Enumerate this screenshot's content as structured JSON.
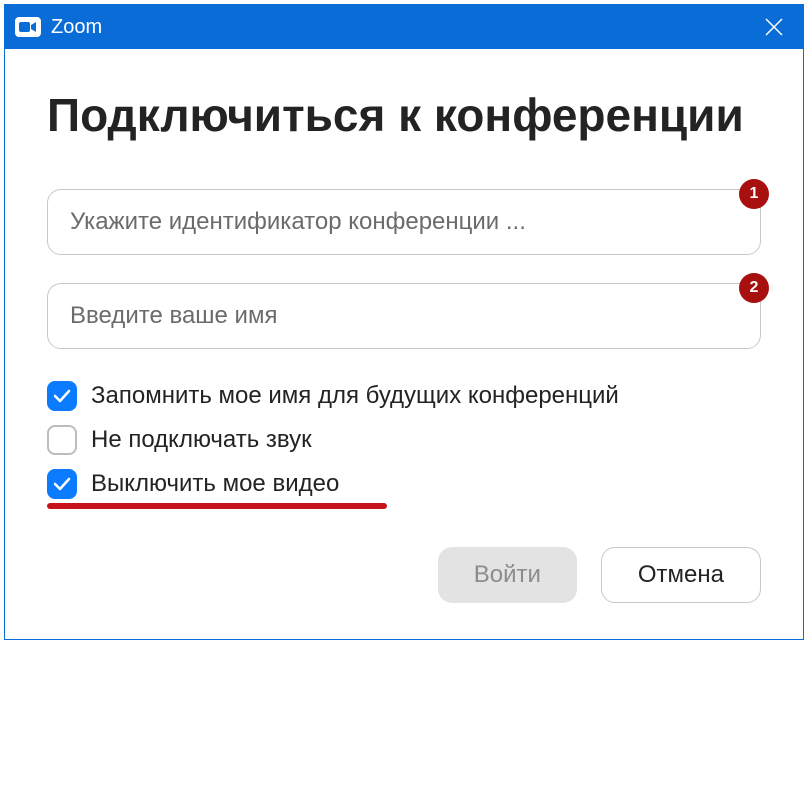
{
  "titlebar": {
    "title": "Zoom"
  },
  "heading": "Подключиться к конференции",
  "inputs": {
    "meeting_id": {
      "placeholder": "Укажите идентификатор конференции ...",
      "badge": "1"
    },
    "name": {
      "placeholder": "Введите ваше имя",
      "badge": "2"
    }
  },
  "checkboxes": {
    "remember_name": {
      "label": "Запомнить мое имя для будущих конференций",
      "checked": true
    },
    "no_audio": {
      "label": "Не подключать звук",
      "checked": false
    },
    "no_video": {
      "label": "Выключить мое видео",
      "checked": true
    }
  },
  "buttons": {
    "join": "Войти",
    "cancel": "Отмена"
  }
}
